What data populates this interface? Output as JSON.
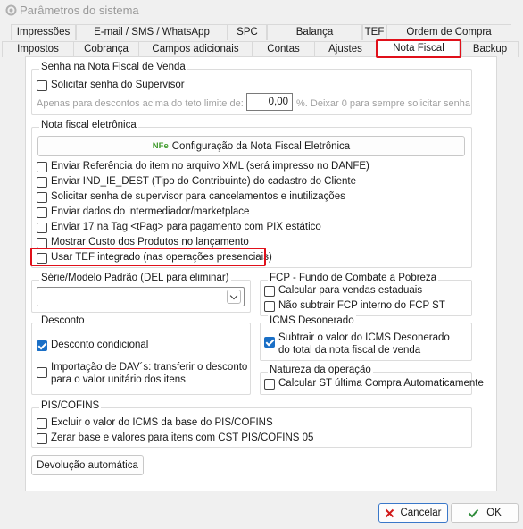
{
  "window": {
    "title": "Parâmetros do sistema"
  },
  "tabs_row1": [
    "Impressões",
    "E-mail / SMS / WhatsApp",
    "SPC",
    "Balança",
    "TEF",
    "Ordem de Compra"
  ],
  "tabs_row2": [
    "Impostos",
    "Cobrança",
    "Campos adicionais",
    "Contas",
    "Ajustes",
    "Nota Fiscal",
    "Backup"
  ],
  "active_tab": "Nota Fiscal",
  "senha_group": {
    "label": "Senha na Nota Fiscal de Venda",
    "solicitar": {
      "label": "Solicitar senha do Supervisor",
      "checked": false
    },
    "desconto_prefix": "Apenas para descontos acima do teto limite de:",
    "desconto_value": "0,00",
    "desconto_suffix": "%. Deixar 0 para sempre solicitar senha"
  },
  "nfe_group": {
    "label": "Nota fiscal eletrônica",
    "config_button": {
      "badge": "NFe",
      "label": "Configuração da Nota Fiscal Eletrônica"
    },
    "options": [
      {
        "label": "Enviar Referência do item no arquivo XML (será impresso no DANFE)",
        "checked": false
      },
      {
        "label": "Enviar IND_IE_DEST (Tipo do Contribuinte) do cadastro do Cliente",
        "checked": false
      },
      {
        "label": "Solicitar senha de supervisor para cancelamentos e inutilizações",
        "checked": false
      },
      {
        "label": "Enviar dados do intermediador/marketplace",
        "checked": false
      },
      {
        "label": "Enviar 17 na Tag <tPag> para pagamento com PIX estático",
        "checked": false
      },
      {
        "label": "Mostrar Custo dos Produtos no lançamento",
        "checked": false
      },
      {
        "label": "Usar TEF integrado (nas operações presenciais)",
        "checked": false
      }
    ]
  },
  "serie_group": {
    "label": "Série/Modelo Padrão (DEL para eliminar)",
    "value": ""
  },
  "fcp_group": {
    "label": "FCP - Fundo de Combate a Pobreza",
    "options": [
      {
        "label": "Calcular para vendas estaduais",
        "checked": false
      },
      {
        "label": "Não subtrair FCP interno do FCP ST",
        "checked": false
      }
    ]
  },
  "desconto_group": {
    "label": "Desconto",
    "condicional": {
      "label": "Desconto condicional",
      "checked": true
    },
    "importacao": {
      "line1": "Importação de DAV´s: transferir o desconto",
      "line2": "para o valor unitário dos itens",
      "checked": false
    }
  },
  "icms_group": {
    "label": "ICMS Desonerado",
    "option": {
      "line1": "Subtrair o valor do ICMS Desonerado",
      "line2": "do total da nota fiscal de venda",
      "checked": true
    }
  },
  "natureza_group": {
    "label": "Natureza da operação",
    "option": {
      "label": "Calcular ST última Compra Automaticamente",
      "checked": false
    }
  },
  "pis_group": {
    "label": "PIS/COFINS",
    "options": [
      {
        "label": "Excluir o valor do ICMS da base do PIS/COFINS",
        "checked": false
      },
      {
        "label": "Zerar base e valores para itens com CST PIS/COFINS 05",
        "checked": false
      }
    ]
  },
  "devolucao_button": "Devolução automática",
  "footer": {
    "cancel": "Cancelar",
    "ok": "OK"
  },
  "colors": {
    "accent": "#1a6fc6",
    "highlight": "#e0101a",
    "nfe_badge": "#3f9a2c",
    "cancel_x": "#d11a1a",
    "ok_check": "#2e8b3a"
  }
}
